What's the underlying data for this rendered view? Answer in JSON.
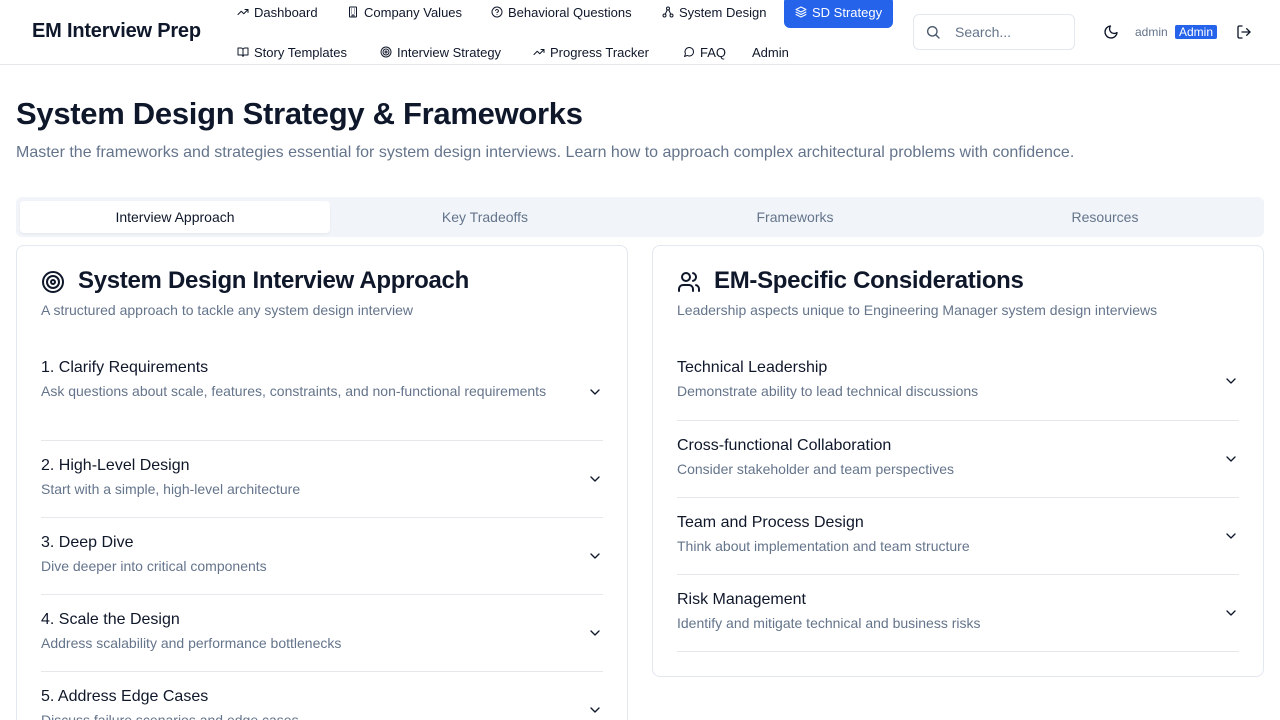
{
  "app": {
    "brand": "EM Interview Prep"
  },
  "nav": {
    "dashboard": "Dashboard",
    "company_values": "Company Values",
    "behavioral_questions": "Behavioral Questions",
    "system_design": "System Design",
    "sd_strategy": "SD Strategy",
    "story_templates": "Story Templates",
    "interview_strategy": "Interview Strategy",
    "progress_tracker": "Progress Tracker",
    "faq": "FAQ",
    "admin": "Admin",
    "active": "SD Strategy"
  },
  "search": {
    "placeholder": "Search..."
  },
  "user": {
    "name": "admin",
    "role": "Admin"
  },
  "page": {
    "title": "System Design Strategy & Frameworks",
    "subtitle": "Master the frameworks and strategies essential for system design interviews. Learn how to approach complex architectural problems with confidence."
  },
  "tabs": {
    "items": [
      {
        "label": "Interview Approach"
      },
      {
        "label": "Key Tradeoffs"
      },
      {
        "label": "Frameworks"
      },
      {
        "label": "Resources"
      }
    ],
    "active": "Interview Approach"
  },
  "approach_card": {
    "icon": "target-icon",
    "title": "System Design Interview Approach",
    "description": "A structured approach to tackle any system design interview",
    "steps": [
      {
        "title": "1. Clarify Requirements",
        "subtitle": "Ask questions about scale, features, constraints, and non-functional requirements"
      },
      {
        "title": "2. High-Level Design",
        "subtitle": "Start with a simple, high-level architecture"
      },
      {
        "title": "3. Deep Dive",
        "subtitle": "Dive deeper into critical components"
      },
      {
        "title": "4. Scale the Design",
        "subtitle": "Address scalability and performance bottlenecks"
      },
      {
        "title": "5. Address Edge Cases",
        "subtitle": "Discuss failure scenarios and edge cases"
      }
    ]
  },
  "em_card": {
    "icon": "users-icon",
    "title": "EM-Specific Considerations",
    "description": "Leadership aspects unique to Engineering Manager system design interviews",
    "items": [
      {
        "title": "Technical Leadership",
        "subtitle": "Demonstrate ability to lead technical discussions"
      },
      {
        "title": "Cross-functional Collaboration",
        "subtitle": "Consider stakeholder and team perspectives"
      },
      {
        "title": "Team and Process Design",
        "subtitle": "Think about implementation and team structure"
      },
      {
        "title": "Risk Management",
        "subtitle": "Identify and mitigate technical and business risks"
      }
    ]
  },
  "colors": {
    "accent": "#2563eb",
    "text": "#0f172a",
    "muted": "#64748b",
    "border": "#e2e8f0",
    "tab_bg": "#f1f5f9"
  }
}
